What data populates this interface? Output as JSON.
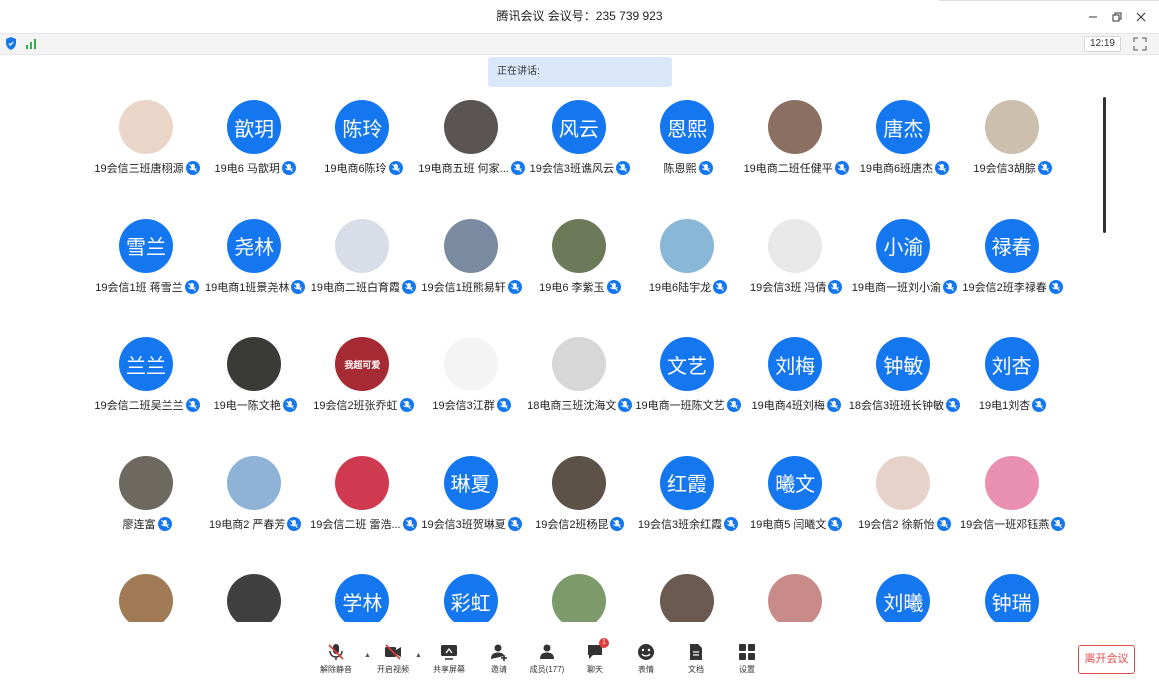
{
  "window": {
    "title": "腾讯会议 会议号：235 739 923"
  },
  "status": {
    "clock": "12:19"
  },
  "speaking": {
    "label": "正在讲话:"
  },
  "participants": [
    {
      "name": "19会信三班唐栩源",
      "avatar": "photo",
      "color": "#e9d6c8"
    },
    {
      "name": "19电6 马歆玥",
      "avatar": "text",
      "initials": "歆玥"
    },
    {
      "name": "19电商6陈玲",
      "avatar": "text",
      "initials": "陈玲"
    },
    {
      "name": "19电商五班 何家...",
      "avatar": "photo",
      "color": "#5a5452"
    },
    {
      "name": "19会信3班谯风云",
      "avatar": "text",
      "initials": "风云"
    },
    {
      "name": "陈恩熙",
      "avatar": "text",
      "initials": "恩熙"
    },
    {
      "name": "19电商二班任健平",
      "avatar": "photo",
      "color": "#8a6f62"
    },
    {
      "name": "19电商6班唐杰",
      "avatar": "text",
      "initials": "唐杰"
    },
    {
      "name": "19会信3胡腙",
      "avatar": "photo",
      "color": "#cdbfae"
    },
    {
      "name": "19会信1班 蒋雪兰",
      "avatar": "text",
      "initials": "雪兰"
    },
    {
      "name": "19电商1班景尧林",
      "avatar": "text",
      "initials": "尧林"
    },
    {
      "name": "19电商二班白育霞",
      "avatar": "photo",
      "color": "#d9dde8"
    },
    {
      "name": "19会信1班熊易轩",
      "avatar": "photo",
      "color": "#7a8aa0"
    },
    {
      "name": "19电6 李紫玉",
      "avatar": "photo",
      "color": "#6c7a5a"
    },
    {
      "name": "19电6陆宇龙",
      "avatar": "photo",
      "color": "#88b7d8"
    },
    {
      "name": "19会信3班 冯倩",
      "avatar": "photo",
      "color": "#e8e8e8"
    },
    {
      "name": "19电商一班刘小渝",
      "avatar": "text",
      "initials": "小渝"
    },
    {
      "name": "19会信2班李禄春",
      "avatar": "text",
      "initials": "禄春"
    },
    {
      "name": "19会信二班吴兰兰",
      "avatar": "text",
      "initials": "兰兰"
    },
    {
      "name": "19电一陈文艳",
      "avatar": "photo",
      "color": "#3a3a36"
    },
    {
      "name": "19会信2班张乔虹",
      "avatar": "photo",
      "color": "#a62a34",
      "badge": "我超可爱"
    },
    {
      "name": "19会信3江群",
      "avatar": "photo",
      "color": "#f4f4f4"
    },
    {
      "name": "18电商三班沈海文",
      "avatar": "photo",
      "color": "#d7d7d7"
    },
    {
      "name": "19电商一班陈文艺",
      "avatar": "text",
      "initials": "文艺"
    },
    {
      "name": "19电商4班刘梅",
      "avatar": "text",
      "initials": "刘梅"
    },
    {
      "name": "18会信3班班长钟敏",
      "avatar": "text",
      "initials": "钟敏"
    },
    {
      "name": "19电1刘杏",
      "avatar": "text",
      "initials": "刘杏"
    },
    {
      "name": "廖连富",
      "avatar": "photo",
      "color": "#6d6860"
    },
    {
      "name": "19电商2 严春芳",
      "avatar": "photo",
      "color": "#8fb3d6"
    },
    {
      "name": "19会信二班 雷浩...",
      "avatar": "photo",
      "color": "#d03a50"
    },
    {
      "name": "19会信3班贺琳夏",
      "avatar": "text",
      "initials": "琳夏"
    },
    {
      "name": "19会信2班杨昆",
      "avatar": "photo",
      "color": "#5d5247"
    },
    {
      "name": "19会信3班余红霞",
      "avatar": "text",
      "initials": "红霞"
    },
    {
      "name": "19电商5 闫曦文",
      "avatar": "text",
      "initials": "曦文"
    },
    {
      "name": "19会信2 徐新怡",
      "avatar": "photo",
      "color": "#e6d2c8"
    },
    {
      "name": "19会信一班邓钰燕",
      "avatar": "photo",
      "color": "#e98fb0"
    },
    {
      "name": "",
      "avatar": "photo",
      "color": "#a07a55"
    },
    {
      "name": "",
      "avatar": "photo",
      "color": "#404040"
    },
    {
      "name": "",
      "avatar": "text",
      "initials": "学林"
    },
    {
      "name": "",
      "avatar": "text",
      "initials": "彩虹"
    },
    {
      "name": "",
      "avatar": "photo",
      "color": "#7c9a6a"
    },
    {
      "name": "",
      "avatar": "photo",
      "color": "#6a5a50"
    },
    {
      "name": "",
      "avatar": "photo",
      "color": "#c98a8a"
    },
    {
      "name": "",
      "avatar": "text",
      "initials": "刘曦"
    },
    {
      "name": "",
      "avatar": "text",
      "initials": "钟瑞"
    }
  ],
  "toolbar": {
    "unmute": "解除静音",
    "start_video": "开启视频",
    "share_screen": "共享屏幕",
    "invite": "邀请",
    "members": "成员(177)",
    "chat": "聊天",
    "chat_badge": "1",
    "reactions": "表情",
    "docs": "文档",
    "settings": "设置",
    "leave": "离开会议"
  },
  "colors": {
    "accent": "#1577f0",
    "leave": "#e04c4c"
  }
}
